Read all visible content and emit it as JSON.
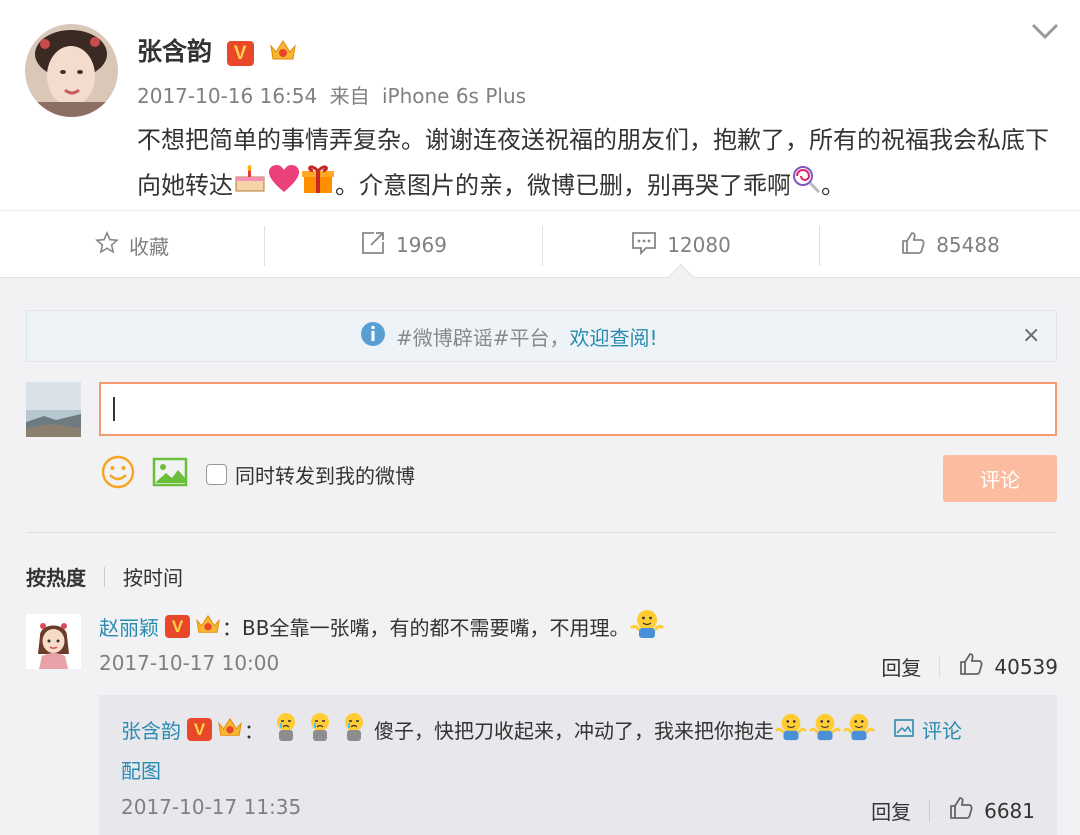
{
  "post": {
    "author": "张含韵",
    "time": "2017-10-16 16:54",
    "from_prefix": "来自",
    "device": "iPhone 6s Plus",
    "text_1": "不想把简单的事情弄复杂。谢谢连夜送祝福的朋友们，抱歉了，所有的祝福我会私底下向她转达",
    "text_2": "。介意图片的亲，微博已删，别再哭了乖啊",
    "text_3": "。",
    "v_badge": "V"
  },
  "actions": {
    "favorite_label": "收藏",
    "repost_count": "1969",
    "comment_count": "12080",
    "like_count": "85488"
  },
  "notice": {
    "hashtag": "#微博辟谣#平台，",
    "link": "欢迎查阅!",
    "close": "×"
  },
  "composer": {
    "input_value": "",
    "sync_label": "同时转发到我的微博",
    "submit_label": "评论"
  },
  "sort": {
    "hot": "按热度",
    "time": "按时间"
  },
  "comments": [
    {
      "author": "赵丽颖",
      "colon": "：",
      "text": "BB全靠一张嘴，有的都不需要嘴，不用理。",
      "time": "2017-10-17 10:00",
      "reply_label": "回复",
      "likes": "40539",
      "reply": {
        "author": "张含韵",
        "colon": "：",
        "text": "傻子，快把刀收起来，冲动了，我来把你抱走",
        "comment_link": "评论配图",
        "comment_link_a": "评论",
        "comment_link_b": "配图",
        "time": "2017-10-17 11:35",
        "reply_label": "回复",
        "likes": "6681"
      }
    }
  ],
  "colors": {
    "link": "#2a8bb0",
    "accent": "#f29b6e",
    "submit_bg": "#fbbca0",
    "v_badge": "#e8472a"
  }
}
